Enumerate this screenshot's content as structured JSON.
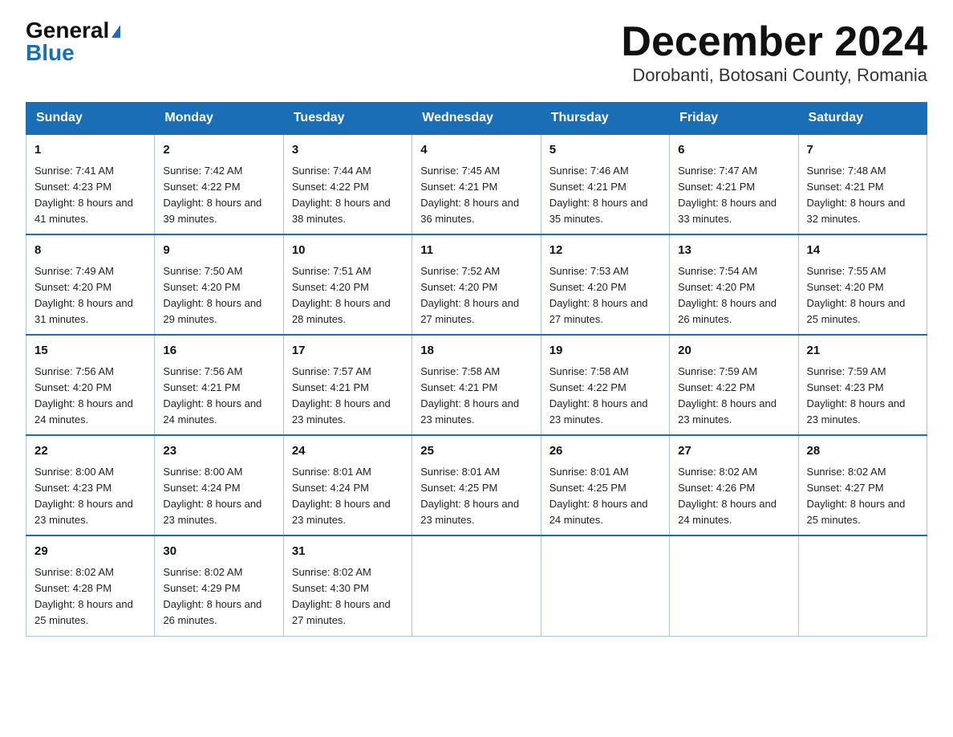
{
  "logo": {
    "general": "General",
    "blue": "Blue"
  },
  "title": "December 2024",
  "subtitle": "Dorobanti, Botosani County, Romania",
  "weekdays": [
    "Sunday",
    "Monday",
    "Tuesday",
    "Wednesday",
    "Thursday",
    "Friday",
    "Saturday"
  ],
  "weeks": [
    [
      {
        "day": "1",
        "sunrise": "7:41 AM",
        "sunset": "4:23 PM",
        "daylight": "8 hours and 41 minutes."
      },
      {
        "day": "2",
        "sunrise": "7:42 AM",
        "sunset": "4:22 PM",
        "daylight": "8 hours and 39 minutes."
      },
      {
        "day": "3",
        "sunrise": "7:44 AM",
        "sunset": "4:22 PM",
        "daylight": "8 hours and 38 minutes."
      },
      {
        "day": "4",
        "sunrise": "7:45 AM",
        "sunset": "4:21 PM",
        "daylight": "8 hours and 36 minutes."
      },
      {
        "day": "5",
        "sunrise": "7:46 AM",
        "sunset": "4:21 PM",
        "daylight": "8 hours and 35 minutes."
      },
      {
        "day": "6",
        "sunrise": "7:47 AM",
        "sunset": "4:21 PM",
        "daylight": "8 hours and 33 minutes."
      },
      {
        "day": "7",
        "sunrise": "7:48 AM",
        "sunset": "4:21 PM",
        "daylight": "8 hours and 32 minutes."
      }
    ],
    [
      {
        "day": "8",
        "sunrise": "7:49 AM",
        "sunset": "4:20 PM",
        "daylight": "8 hours and 31 minutes."
      },
      {
        "day": "9",
        "sunrise": "7:50 AM",
        "sunset": "4:20 PM",
        "daylight": "8 hours and 29 minutes."
      },
      {
        "day": "10",
        "sunrise": "7:51 AM",
        "sunset": "4:20 PM",
        "daylight": "8 hours and 28 minutes."
      },
      {
        "day": "11",
        "sunrise": "7:52 AM",
        "sunset": "4:20 PM",
        "daylight": "8 hours and 27 minutes."
      },
      {
        "day": "12",
        "sunrise": "7:53 AM",
        "sunset": "4:20 PM",
        "daylight": "8 hours and 27 minutes."
      },
      {
        "day": "13",
        "sunrise": "7:54 AM",
        "sunset": "4:20 PM",
        "daylight": "8 hours and 26 minutes."
      },
      {
        "day": "14",
        "sunrise": "7:55 AM",
        "sunset": "4:20 PM",
        "daylight": "8 hours and 25 minutes."
      }
    ],
    [
      {
        "day": "15",
        "sunrise": "7:56 AM",
        "sunset": "4:20 PM",
        "daylight": "8 hours and 24 minutes."
      },
      {
        "day": "16",
        "sunrise": "7:56 AM",
        "sunset": "4:21 PM",
        "daylight": "8 hours and 24 minutes."
      },
      {
        "day": "17",
        "sunrise": "7:57 AM",
        "sunset": "4:21 PM",
        "daylight": "8 hours and 23 minutes."
      },
      {
        "day": "18",
        "sunrise": "7:58 AM",
        "sunset": "4:21 PM",
        "daylight": "8 hours and 23 minutes."
      },
      {
        "day": "19",
        "sunrise": "7:58 AM",
        "sunset": "4:22 PM",
        "daylight": "8 hours and 23 minutes."
      },
      {
        "day": "20",
        "sunrise": "7:59 AM",
        "sunset": "4:22 PM",
        "daylight": "8 hours and 23 minutes."
      },
      {
        "day": "21",
        "sunrise": "7:59 AM",
        "sunset": "4:23 PM",
        "daylight": "8 hours and 23 minutes."
      }
    ],
    [
      {
        "day": "22",
        "sunrise": "8:00 AM",
        "sunset": "4:23 PM",
        "daylight": "8 hours and 23 minutes."
      },
      {
        "day": "23",
        "sunrise": "8:00 AM",
        "sunset": "4:24 PM",
        "daylight": "8 hours and 23 minutes."
      },
      {
        "day": "24",
        "sunrise": "8:01 AM",
        "sunset": "4:24 PM",
        "daylight": "8 hours and 23 minutes."
      },
      {
        "day": "25",
        "sunrise": "8:01 AM",
        "sunset": "4:25 PM",
        "daylight": "8 hours and 23 minutes."
      },
      {
        "day": "26",
        "sunrise": "8:01 AM",
        "sunset": "4:25 PM",
        "daylight": "8 hours and 24 minutes."
      },
      {
        "day": "27",
        "sunrise": "8:02 AM",
        "sunset": "4:26 PM",
        "daylight": "8 hours and 24 minutes."
      },
      {
        "day": "28",
        "sunrise": "8:02 AM",
        "sunset": "4:27 PM",
        "daylight": "8 hours and 25 minutes."
      }
    ],
    [
      {
        "day": "29",
        "sunrise": "8:02 AM",
        "sunset": "4:28 PM",
        "daylight": "8 hours and 25 minutes."
      },
      {
        "day": "30",
        "sunrise": "8:02 AM",
        "sunset": "4:29 PM",
        "daylight": "8 hours and 26 minutes."
      },
      {
        "day": "31",
        "sunrise": "8:02 AM",
        "sunset": "4:30 PM",
        "daylight": "8 hours and 27 minutes."
      },
      null,
      null,
      null,
      null
    ]
  ]
}
